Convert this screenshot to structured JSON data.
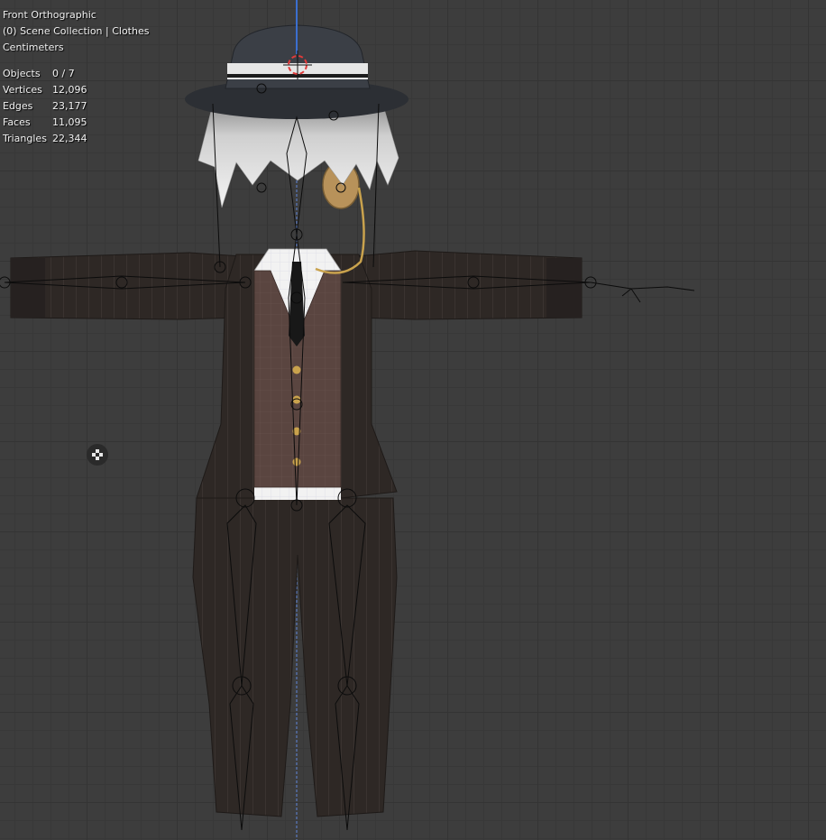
{
  "viewport": {
    "view_name": "Front Orthographic",
    "collection": "(0) Scene Collection | Clothes",
    "units": "Centimeters"
  },
  "stats": [
    {
      "label": "Objects",
      "value": "0 / 7"
    },
    {
      "label": "Vertices",
      "value": "12,096"
    },
    {
      "label": "Edges",
      "value": "23,177"
    },
    {
      "label": "Faces",
      "value": "11,095"
    },
    {
      "label": "Triangles",
      "value": "22,344"
    }
  ],
  "icons": {
    "viewport_gizmo": "camera-toggle-icon",
    "origin": "3d-cursor-icon"
  },
  "colors": {
    "background": "#3d3d3d",
    "grid": "#343434",
    "suit": "#2f2926",
    "vest": "#5a4540",
    "shirt": "#f0f0f0",
    "hat": "#3b3f46",
    "hair": "#d8d8d8",
    "gold": "#c9a24d"
  }
}
